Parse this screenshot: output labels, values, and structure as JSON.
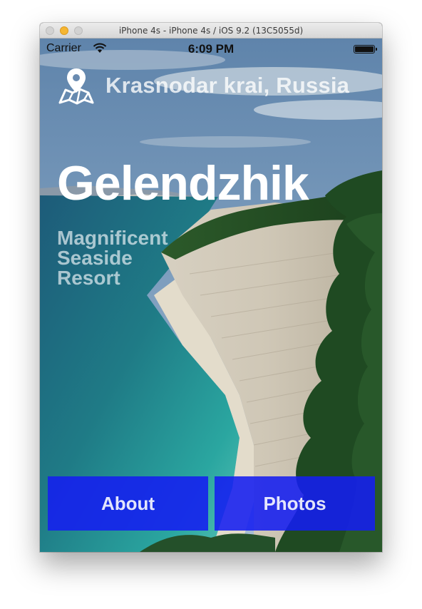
{
  "window": {
    "title": "iPhone 4s - iPhone 4s / iOS 9.2 (13C5055d)"
  },
  "statusbar": {
    "carrier": "Carrier",
    "time": "6:09 PM",
    "battery_level": 1.0
  },
  "header": {
    "location_icon": "map-pin-icon",
    "region": "Krasnodar krai, Russia"
  },
  "main": {
    "city": "Gelendzhik",
    "tagline": [
      "Magnificent",
      "Seaside",
      "Resort"
    ]
  },
  "buttons": {
    "about": "About",
    "photos": "Photos"
  },
  "colors": {
    "button_bg": "#141EF0",
    "button_text": "#FFFFFF",
    "traffic_minimize": "#F5B632"
  }
}
